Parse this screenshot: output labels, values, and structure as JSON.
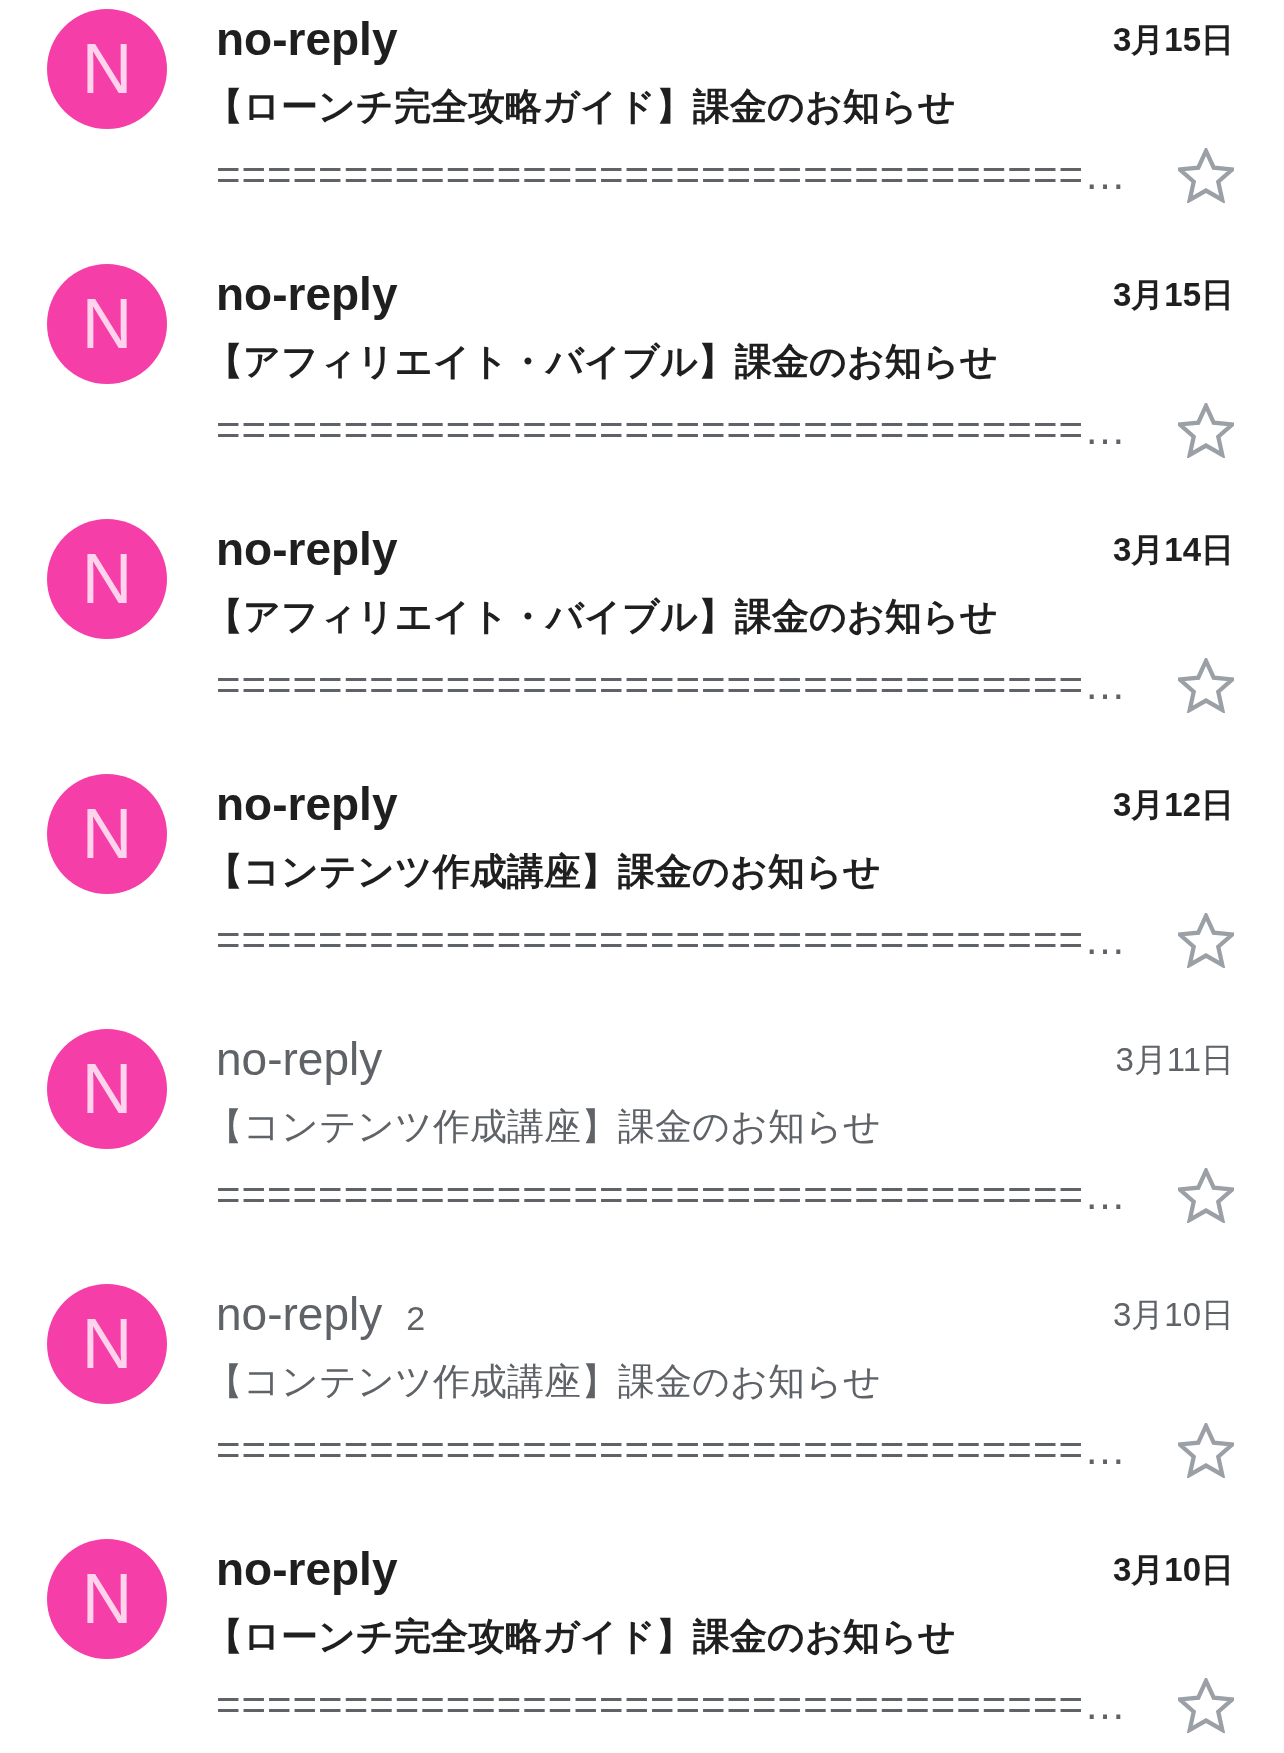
{
  "emails": [
    {
      "avatar_letter": "N",
      "sender": "no-reply",
      "date": "3月15日",
      "subject": "【ローンチ完全攻略ガイド】課金のお知らせ",
      "preview": "==================================…",
      "unread": true,
      "starred": false
    },
    {
      "avatar_letter": "N",
      "sender": "no-reply",
      "date": "3月15日",
      "subject": "【アフィリエイト・バイブル】課金のお知らせ",
      "preview": "==================================…",
      "unread": true,
      "starred": false
    },
    {
      "avatar_letter": "N",
      "sender": "no-reply",
      "date": "3月14日",
      "subject": "【アフィリエイト・バイブル】課金のお知らせ",
      "preview": "==================================…",
      "unread": true,
      "starred": false
    },
    {
      "avatar_letter": "N",
      "sender": "no-reply",
      "date": "3月12日",
      "subject": "【コンテンツ作成講座】課金のお知らせ",
      "preview": "==================================…",
      "unread": true,
      "starred": false
    },
    {
      "avatar_letter": "N",
      "sender": "no-reply",
      "date": "3月11日",
      "subject": "【コンテンツ作成講座】課金のお知らせ",
      "preview": "==================================…",
      "unread": false,
      "starred": false
    },
    {
      "avatar_letter": "N",
      "sender": "no-reply",
      "count": "2",
      "date": "3月10日",
      "subject": "【コンテンツ作成講座】課金のお知らせ",
      "preview": "==================================…",
      "unread": false,
      "starred": false
    },
    {
      "avatar_letter": "N",
      "sender": "no-reply",
      "date": "3月10日",
      "subject": "【ローンチ完全攻略ガイド】課金のお知らせ",
      "preview": "==================================…",
      "unread": true,
      "starred": false
    }
  ]
}
